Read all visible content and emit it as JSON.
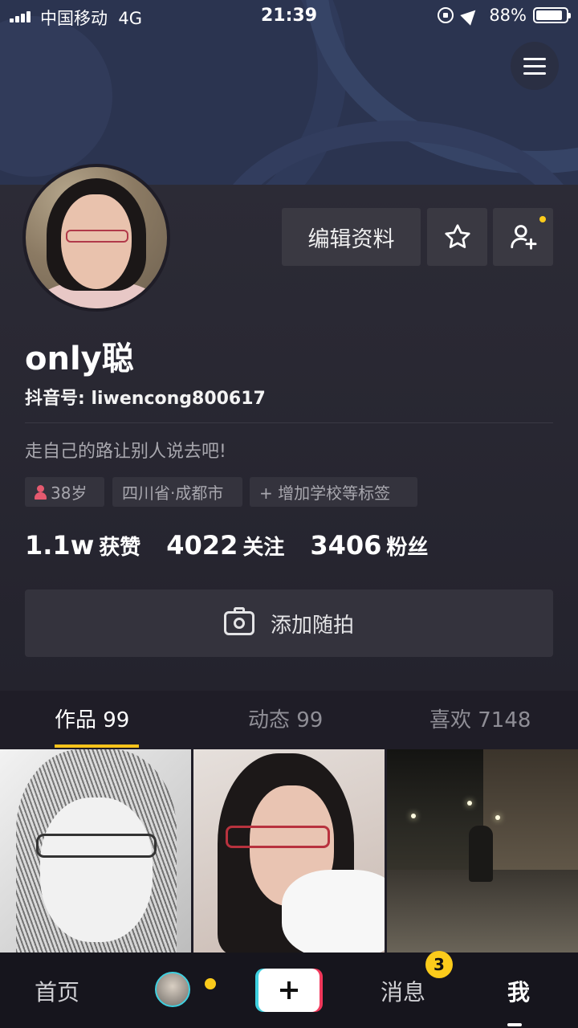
{
  "status_bar": {
    "carrier": "中国移动",
    "network": "4G",
    "time": "21:39",
    "battery": "88%",
    "battery_level": 0.88
  },
  "profile": {
    "name": "only聪",
    "douyin_id": "抖音号: liwencong800617",
    "bio": "走自己的路让别人说去吧!",
    "tags": {
      "age": "38岁",
      "location": "四川省·成都市",
      "add_school": "+ 增加学校等标签"
    }
  },
  "buttons": {
    "edit_profile": "编辑资料",
    "add_snapshot": "添加随拍"
  },
  "stats": [
    {
      "num": "1.1w",
      "label": "获赞"
    },
    {
      "num": "4022",
      "label": "关注"
    },
    {
      "num": "3406",
      "label": "粉丝"
    }
  ],
  "tabs": [
    {
      "label": "作品 99",
      "active": true
    },
    {
      "label": "动态 99",
      "active": false
    },
    {
      "label": "喜欢 7148",
      "active": false
    }
  ],
  "bottom_nav": {
    "home": "首页",
    "messages": "消息",
    "messages_badge": "3",
    "me": "我"
  },
  "colors": {
    "accent_yellow": "#fbcb1b",
    "background": "#1f1d27",
    "banner": "#2b3450",
    "button_bg": "#3a3942",
    "plus_cyan": "#3fd0e0",
    "plus_red": "#f0375a"
  },
  "icons": [
    "menu-icon",
    "star-icon",
    "add-friend-icon",
    "camera-icon",
    "gender-female-icon",
    "plus-icon"
  ]
}
